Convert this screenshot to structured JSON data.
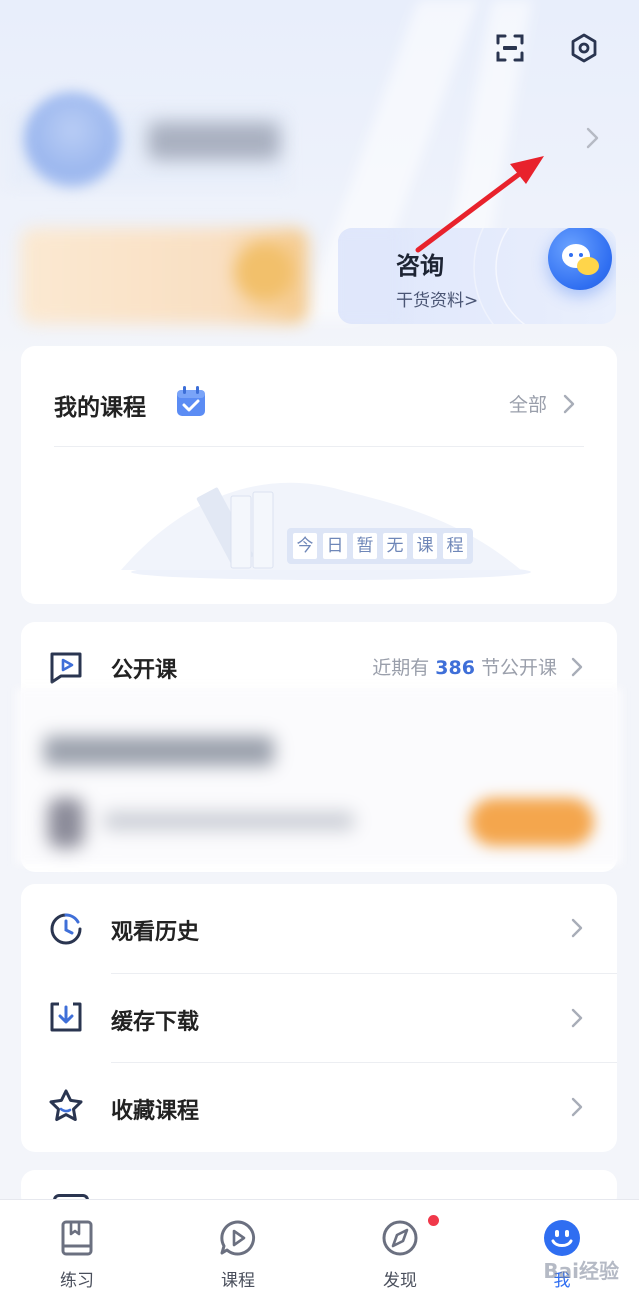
{
  "colors": {
    "accent": "#2f6ef1",
    "link_number": "#3f6fd8",
    "tab_active": "#2f6ef1",
    "badge": "#f0384a",
    "annotation": "#e8222c"
  },
  "header": {
    "scan_icon": "scan-icon",
    "settings_icon": "settings-hex-icon"
  },
  "profile": {
    "chevron": "›"
  },
  "consult_banner": {
    "title": "咨询",
    "subtitle": "干货资料>"
  },
  "my_courses": {
    "title": "我的课程",
    "all_label": "全部",
    "empty_chars": [
      "今",
      "日",
      "暂",
      "无",
      "课",
      "程"
    ]
  },
  "open_course": {
    "title": "公开课",
    "prefix": "近期有",
    "count": "386",
    "suffix": "节公开课"
  },
  "menu": [
    {
      "label": "观看历史",
      "icon": "history-clock-icon"
    },
    {
      "label": "缓存下载",
      "icon": "download-icon"
    },
    {
      "label": "收藏课程",
      "icon": "star-icon"
    }
  ],
  "tabbar": [
    {
      "label": "练习",
      "icon": "practice-book-icon"
    },
    {
      "label": "课程",
      "icon": "course-play-icon"
    },
    {
      "label": "发现",
      "icon": "compass-icon"
    },
    {
      "label": "我",
      "icon": "smile-face-icon"
    }
  ],
  "watermark": "Bai经验"
}
